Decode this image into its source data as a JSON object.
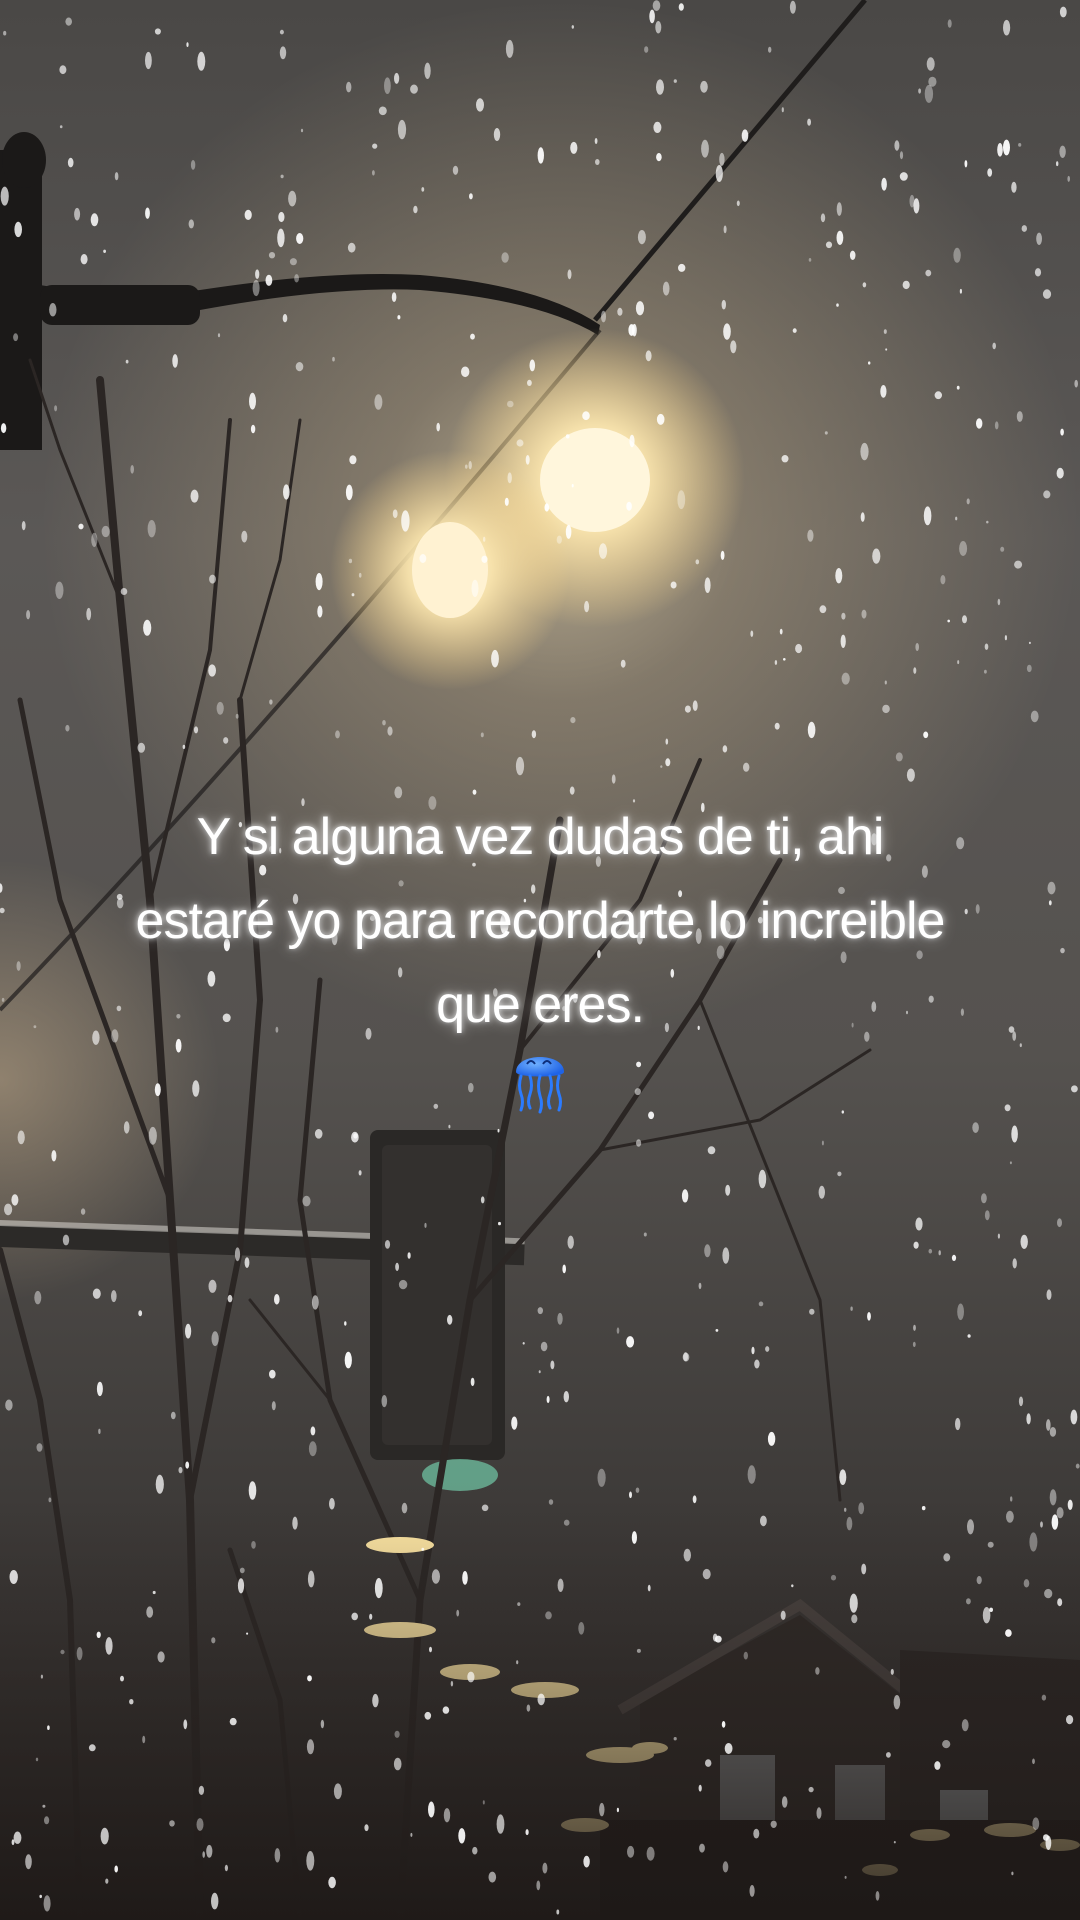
{
  "quote": {
    "lines": [
      "Y si alguna vez dudas de ti, ahi",
      "estaré yo para recordarte lo increible",
      "que eres."
    ]
  },
  "emoji": {
    "icon": "jellyfish-icon",
    "color": "#2b7bff"
  },
  "scene": {
    "description_colors": {
      "sky": "#5b5856",
      "lamp_glow": "#fff3d6",
      "ground_dark": "#2a2523"
    }
  }
}
